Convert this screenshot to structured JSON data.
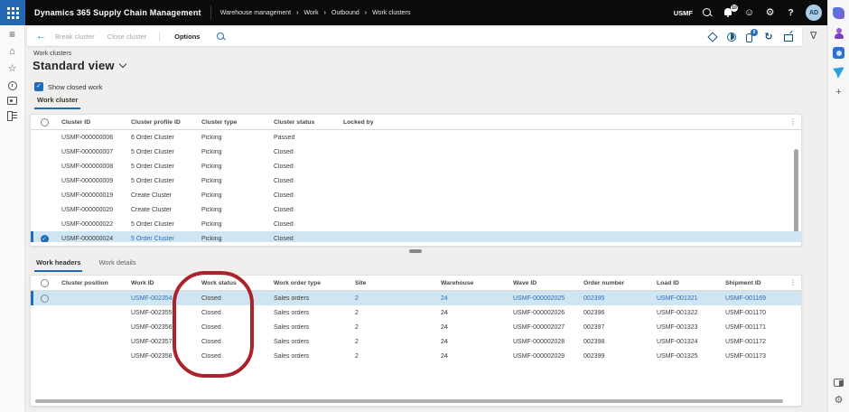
{
  "topbar": {
    "app_title": "Dynamics 365 Supply Chain Management",
    "breadcrumb": [
      "Warehouse management",
      "Work",
      "Outbound",
      "Work clusters"
    ],
    "company": "USMF",
    "notification_count": "10",
    "avatar_initials": "AD",
    "icons": [
      "search-icon",
      "notifications-bell-icon",
      "feedback-smiley-icon",
      "settings-gear-icon",
      "help-icon"
    ]
  },
  "action_bar": {
    "back_glyph": "←",
    "buttons": [
      {
        "label": "Break cluster",
        "disabled": true
      },
      {
        "label": "Close cluster",
        "disabled": true
      },
      {
        "label": "Options",
        "disabled": false
      }
    ],
    "right_icons": [
      "office-apps-icon",
      "contrast-view-icon",
      "attachments-icon",
      "refresh-icon",
      "open-in-new-window-icon"
    ],
    "attachment_count": "0"
  },
  "page": {
    "caption": "Work clusters",
    "title": "Standard view",
    "show_closed_label": "Show closed work",
    "show_closed_checked": true
  },
  "cluster_section": {
    "tab_label": "Work cluster",
    "grid": {
      "columns": [
        "Cluster ID",
        "Cluster profile ID",
        "Cluster type",
        "Cluster status",
        "Locked by"
      ],
      "selected_link_cols": [
        1
      ],
      "selected_check_filled": true,
      "rows": [
        {
          "cells": [
            "USMF-000000006",
            "6 Order Cluster",
            "Picking",
            "Passed",
            ""
          ]
        },
        {
          "cells": [
            "USMF-000000007",
            "5 Order Cluster",
            "Picking",
            "Closed",
            ""
          ]
        },
        {
          "cells": [
            "USMF-000000008",
            "5 Order Cluster",
            "Picking",
            "Closed",
            ""
          ]
        },
        {
          "cells": [
            "USMF-000000009",
            "5 Order Cluster",
            "Picking",
            "Closed",
            ""
          ]
        },
        {
          "cells": [
            "USMF-000000019",
            "Create Cluster",
            "Picking",
            "Closed",
            ""
          ]
        },
        {
          "cells": [
            "USMF-000000020",
            "Create Cluster",
            "Picking",
            "Closed",
            ""
          ]
        },
        {
          "cells": [
            "USMF-000000022",
            "5 Order Cluster",
            "Picking",
            "Closed",
            ""
          ]
        },
        {
          "cells": [
            "USMF-000000024",
            "5 Order Cluster",
            "Picking",
            "Closed",
            ""
          ],
          "selected": true
        }
      ]
    }
  },
  "work_section": {
    "tabs": [
      {
        "label": "Work headers",
        "active": true
      },
      {
        "label": "Work details",
        "active": false
      }
    ],
    "grid": {
      "columns": [
        "Cluster position",
        "Work ID",
        "Work status",
        "Work order type",
        "Site",
        "Warehouse",
        "Wave ID",
        "Order number",
        "Load ID",
        "Shipment ID"
      ],
      "selected_link_cols": [
        1,
        4,
        5,
        6,
        7,
        8,
        9
      ],
      "selected_check_filled": false,
      "rows": [
        {
          "cells": [
            "",
            "USMF-002354",
            "Closed",
            "Sales orders",
            "2",
            "24",
            "USMF-000002025",
            "002395",
            "USMF-001321",
            "USMF-001169"
          ],
          "selected": true
        },
        {
          "cells": [
            "",
            "USMF-002355",
            "Closed",
            "Sales orders",
            "2",
            "24",
            "USMF-000002026",
            "002396",
            "USMF-001322",
            "USMF-001170"
          ]
        },
        {
          "cells": [
            "",
            "USMF-002356",
            "Closed",
            "Sales orders",
            "2",
            "24",
            "USMF-000002027",
            "002397",
            "USMF-001323",
            "USMF-001171"
          ]
        },
        {
          "cells": [
            "",
            "USMF-002357",
            "Closed",
            "Sales orders",
            "2",
            "24",
            "USMF-000002028",
            "002398",
            "USMF-001324",
            "USMF-001172"
          ]
        },
        {
          "cells": [
            "",
            "USMF-002358",
            "Closed",
            "Sales orders",
            "2",
            "24",
            "USMF-000002029",
            "002399",
            "USMF-001325",
            "USMF-001173"
          ]
        }
      ]
    }
  },
  "annotation": {
    "shape": "red-ellipse",
    "target": "Work status column",
    "color": "#a8242a"
  },
  "browser_sidebar": {
    "icons": [
      "shopping-tag-icon",
      "profile-person-icon",
      "visual-search-camera-icon",
      "drop-plane-icon",
      "add-icon",
      "panel-toggle-icon",
      "sidebar-settings-gear-icon"
    ]
  },
  "colors": {
    "accent": "#1f6cb8",
    "link": "#2b6cb8",
    "selected_row": "#d0e5f2",
    "topbar_bg": "#0b0b0b",
    "waffle_bg": "#2268b2",
    "annotation": "#a8242a"
  }
}
